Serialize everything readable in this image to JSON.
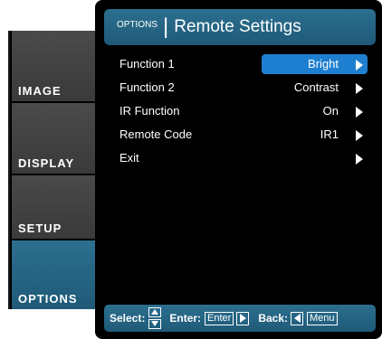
{
  "tabs": [
    {
      "label": "IMAGE"
    },
    {
      "label": "DISPLAY"
    },
    {
      "label": "SETUP"
    },
    {
      "label": "OPTIONS"
    }
  ],
  "header": {
    "category": "OPTIONS",
    "separator": "|",
    "title": "Remote Settings"
  },
  "rows": [
    {
      "label": "Function 1",
      "value": "Bright"
    },
    {
      "label": "Function 2",
      "value": "Contrast"
    },
    {
      "label": "IR Function",
      "value": "On"
    },
    {
      "label": "Remote Code",
      "value": "IR1"
    },
    {
      "label": "Exit",
      "value": ""
    }
  ],
  "footer": {
    "select_label": "Select:",
    "enter_label": "Enter:",
    "enter_key": "Enter",
    "back_label": "Back:",
    "menu_key": "Menu"
  },
  "colors": {
    "accent": "#2c6f8f",
    "highlight": "#1e7fd0",
    "panel": "#000000"
  }
}
